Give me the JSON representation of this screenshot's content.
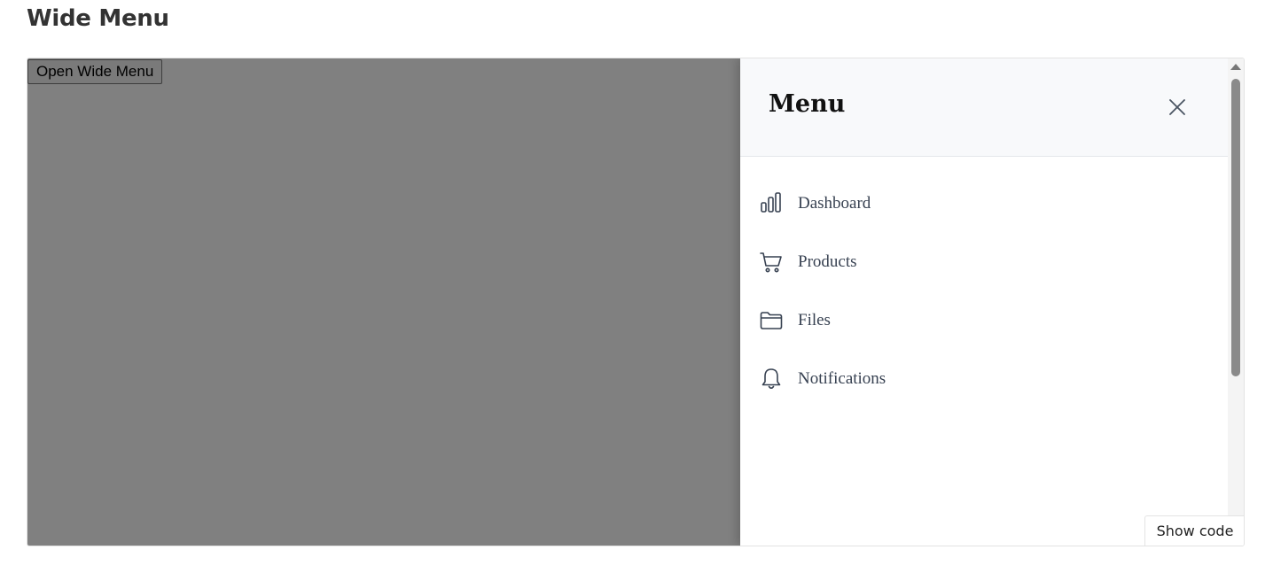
{
  "page": {
    "title": "Wide Menu"
  },
  "demo": {
    "open_button_label": "Open Wide Menu",
    "show_code_label": "Show code"
  },
  "drawer": {
    "title": "Menu",
    "close_icon": "close-icon",
    "items": [
      {
        "label": "Dashboard",
        "icon": "bar-chart-icon"
      },
      {
        "label": "Products",
        "icon": "shopping-cart-icon"
      },
      {
        "label": "Files",
        "icon": "folder-icon"
      },
      {
        "label": "Notifications",
        "icon": "bell-icon"
      }
    ]
  },
  "colors": {
    "overlay": "#808080",
    "header_bg": "#f8f9fb",
    "menu_text": "#374151",
    "icon_stroke": "#374151"
  }
}
